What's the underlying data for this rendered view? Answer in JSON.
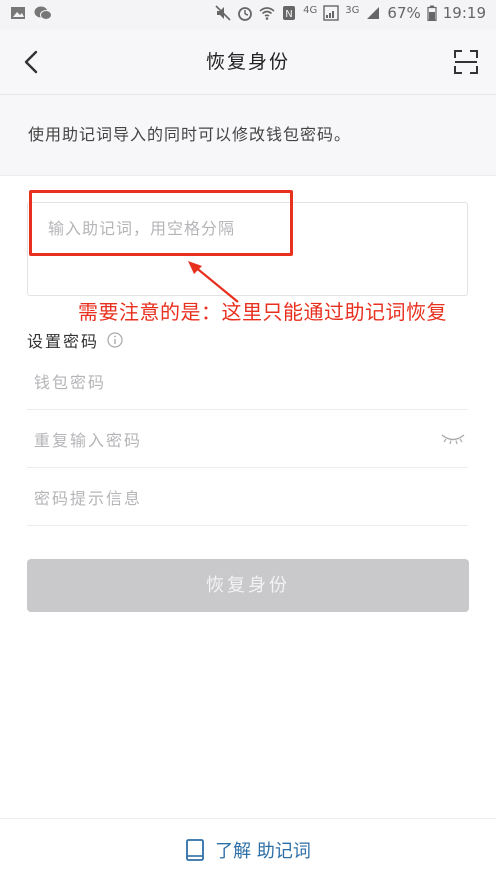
{
  "status_bar": {
    "battery_percent": "67%",
    "time": "19:19",
    "network_4g": "4G",
    "network_3g": "3G",
    "icons": [
      "gallery-icon",
      "wechat-icon",
      "mute-icon",
      "alarm-icon",
      "wifi-icon",
      "nfc-icon",
      "signal-icon",
      "battery-icon"
    ]
  },
  "nav": {
    "title": "恢复身份",
    "back_icon": "back-chevron-icon",
    "scan_icon": "scan-icon"
  },
  "description": "使用助记词导入的同时可以修改钱包密码。",
  "mnemonic": {
    "value": "",
    "placeholder": "输入助记词，用空格分隔"
  },
  "annotation": {
    "text": "需要注意的是：这里只能通过助记词恢复",
    "color": "#e8301f"
  },
  "password_section": {
    "title": "设置密码",
    "info_icon": "info-icon",
    "fields": [
      {
        "value": "",
        "placeholder": "钱包密码"
      },
      {
        "value": "",
        "placeholder": "重复输入密码"
      },
      {
        "value": "",
        "placeholder": "密码提示信息"
      }
    ]
  },
  "restore_button": {
    "label": "恢复身份",
    "state": "disabled"
  },
  "learn": {
    "icon": "book-icon",
    "label": "了解 助记词",
    "color": "#2f6fa7"
  }
}
